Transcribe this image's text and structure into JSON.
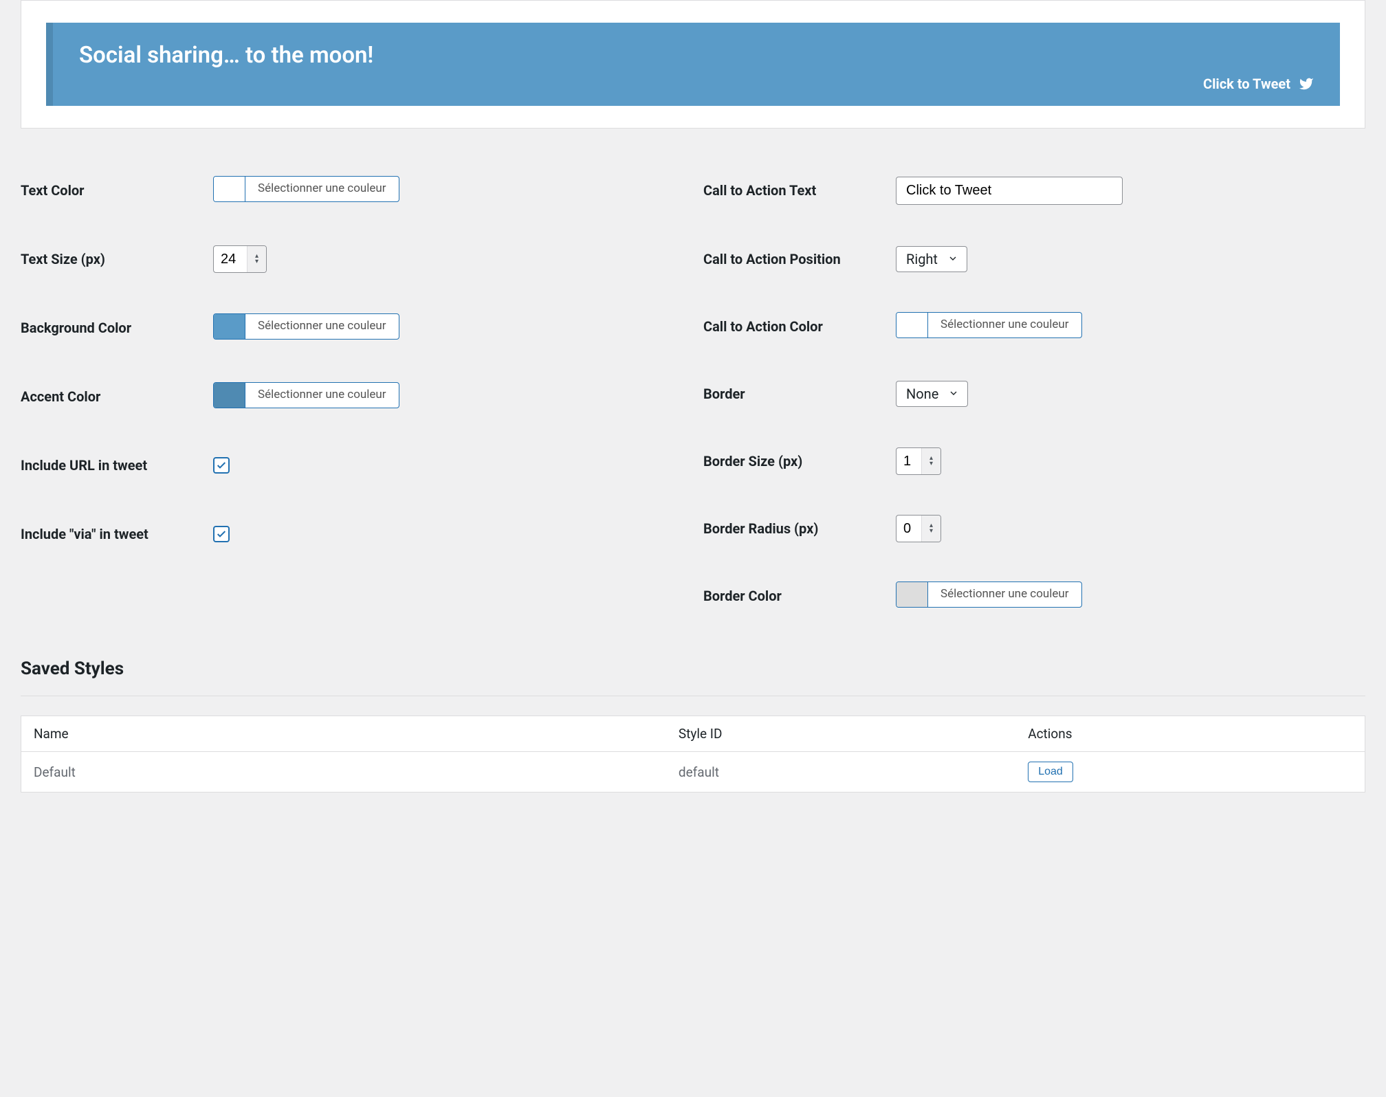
{
  "preview": {
    "tweet_text": "Social sharing… to the moon!",
    "cta_text": "Click to Tweet"
  },
  "colors": {
    "text_color": "#ffffff",
    "background_color": "#5a9bc8",
    "accent_color": "#4f8ab2",
    "cta_color": "#ffffff",
    "border_color": "#dddddd"
  },
  "color_picker_label": "Sélectionner une couleur",
  "labels": {
    "text_color": "Text Color",
    "text_size": "Text Size (px)",
    "background_color": "Background Color",
    "accent_color": "Accent Color",
    "include_url": "Include URL in tweet",
    "include_via": "Include \"via\" in tweet",
    "cta_text": "Call to Action Text",
    "cta_position": "Call to Action Position",
    "cta_color": "Call to Action Color",
    "border": "Border",
    "border_size": "Border Size (px)",
    "border_radius": "Border Radius (px)",
    "border_color": "Border Color"
  },
  "fields": {
    "text_size": "24",
    "include_url": true,
    "include_via": true,
    "cta_text": "Click to Tweet",
    "cta_position": "Right",
    "border": "None",
    "border_size": "1",
    "border_radius": "0"
  },
  "saved_styles": {
    "heading": "Saved Styles",
    "columns": {
      "name": "Name",
      "style_id": "Style ID",
      "actions": "Actions"
    },
    "rows": [
      {
        "name": "Default",
        "style_id": "default",
        "action_label": "Load"
      }
    ]
  }
}
